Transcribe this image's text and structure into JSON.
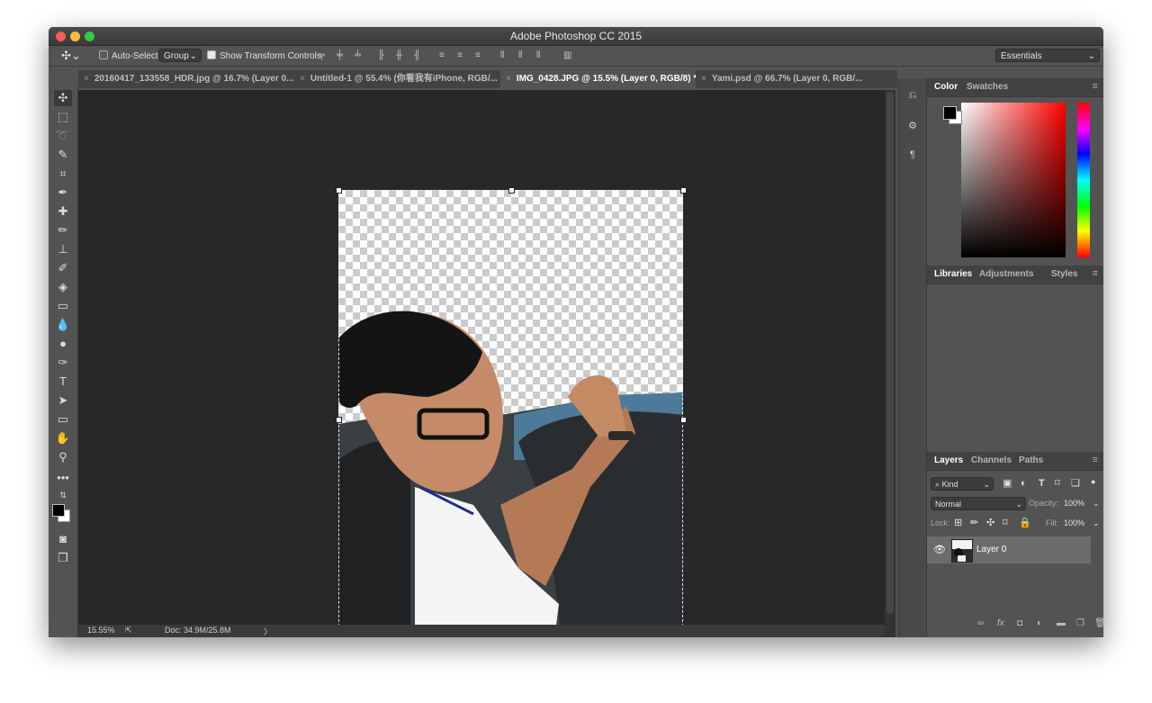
{
  "window": {
    "title": "Adobe Photoshop CC 2015"
  },
  "options_bar": {
    "auto_select_label": "Auto-Select:",
    "auto_select_value": "Group",
    "show_transform_label": "Show Transform Controls",
    "workspace": "Essentials"
  },
  "doc_tabs": [
    {
      "label": "20160417_133558_HDR.jpg @ 16.7% (Layer 0...",
      "active": false
    },
    {
      "label": "Untitled-1 @ 55.4% (你看我有iPhone, RGB/...",
      "active": false
    },
    {
      "label": "IMG_0428.JPG @ 15.5% (Layer 0, RGB/8) *",
      "active": true
    },
    {
      "label": "Yami.psd @ 66.7% (Layer 0, RGB/...",
      "active": false
    }
  ],
  "status": {
    "zoom": "15.55%",
    "doc": "Doc: 34.9M/25.8M"
  },
  "color_panel": {
    "tabs": [
      "Color",
      "Swatches"
    ],
    "foreground": "#000000",
    "background": "#ffffff"
  },
  "libraries_panel": {
    "tabs": [
      "Libraries",
      "Adjustments",
      "Styles"
    ]
  },
  "layers_panel": {
    "tabs": [
      "Layers",
      "Channels",
      "Paths"
    ],
    "filter": "Kind",
    "blend_mode": "Normal",
    "opacity_label": "Opacity:",
    "opacity_value": "100%",
    "lock_label": "Lock:",
    "fill_label": "Fill:",
    "fill_value": "100%",
    "layers": [
      {
        "name": "Layer 0",
        "visible": true
      }
    ]
  }
}
